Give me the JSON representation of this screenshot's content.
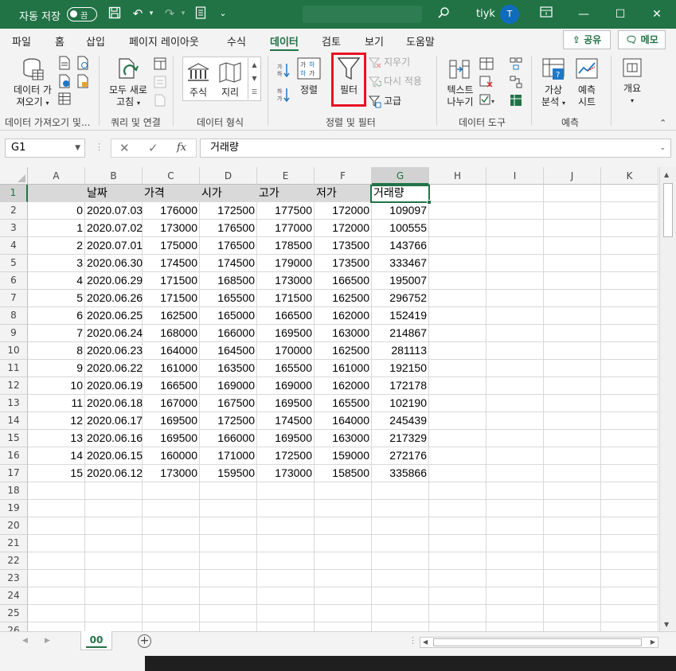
{
  "titlebar": {
    "autosave_label": "자동 저장",
    "autosave_state": "끔",
    "user_name": "tiyk",
    "avatar_initial": "T"
  },
  "ribbon_tabs": [
    "파일",
    "홈",
    "삽입",
    "페이지 레이아웃",
    "수식",
    "데이터",
    "검토",
    "보기",
    "도움말"
  ],
  "active_tab": "데이터",
  "share_label": "공유",
  "memo_label": "메모",
  "ribbon": {
    "get_data_line1": "데이터 가",
    "get_data_line2": "져오기",
    "refresh_line1": "모두 새로",
    "refresh_line2": "고침",
    "stocks": "주식",
    "geography": "지리",
    "sort": "정렬",
    "filter": "필터",
    "clear": "지우기",
    "reapply": "다시 적용",
    "advanced": "고급",
    "text_to_columns_line1": "텍스트",
    "text_to_columns_line2": "나누기",
    "whatif_line1": "가상",
    "whatif_line2": "분석",
    "forecast_line1": "예측",
    "forecast_line2": "시트",
    "outline": "개요",
    "groups": [
      "데이터 가져오기 및...",
      "쿼리 및 연결",
      "데이터 형식",
      "정렬 및 필터",
      "데이터 도구",
      "예측"
    ]
  },
  "formula_bar": {
    "name_box": "G1",
    "fx_label": "fx",
    "formula": "거래량"
  },
  "columns": [
    "A",
    "B",
    "C",
    "D",
    "E",
    "F",
    "G",
    "H",
    "I",
    "J",
    "K"
  ],
  "header_row": [
    "",
    "날짜",
    "가격",
    "시가",
    "고가",
    "저가",
    "거래량"
  ],
  "data_rows": [
    [
      "0",
      "2020.07.03",
      "176000",
      "172500",
      "177500",
      "172000",
      "109097"
    ],
    [
      "1",
      "2020.07.02",
      "173000",
      "176500",
      "177000",
      "172000",
      "100555"
    ],
    [
      "2",
      "2020.07.01",
      "175000",
      "176500",
      "178500",
      "173500",
      "143766"
    ],
    [
      "3",
      "2020.06.30",
      "174500",
      "174500",
      "179000",
      "173500",
      "333467"
    ],
    [
      "4",
      "2020.06.29",
      "171500",
      "168500",
      "173000",
      "166500",
      "195007"
    ],
    [
      "5",
      "2020.06.26",
      "171500",
      "165500",
      "171500",
      "162500",
      "296752"
    ],
    [
      "6",
      "2020.06.25",
      "162500",
      "165000",
      "166500",
      "162000",
      "152419"
    ],
    [
      "7",
      "2020.06.24",
      "168000",
      "166000",
      "169500",
      "163000",
      "214867"
    ],
    [
      "8",
      "2020.06.23",
      "164000",
      "164500",
      "170000",
      "162500",
      "281113"
    ],
    [
      "9",
      "2020.06.22",
      "161000",
      "163500",
      "165500",
      "161000",
      "192150"
    ],
    [
      "10",
      "2020.06.19",
      "166500",
      "169000",
      "169000",
      "162000",
      "172178"
    ],
    [
      "11",
      "2020.06.18",
      "167000",
      "167500",
      "169500",
      "165500",
      "102190"
    ],
    [
      "12",
      "2020.06.17",
      "169500",
      "172500",
      "174500",
      "164000",
      "245439"
    ],
    [
      "13",
      "2020.06.16",
      "169500",
      "166000",
      "169500",
      "163000",
      "217329"
    ],
    [
      "14",
      "2020.06.15",
      "160000",
      "171000",
      "172500",
      "159000",
      "272176"
    ],
    [
      "15",
      "2020.06.12",
      "173000",
      "159500",
      "173000",
      "158500",
      "335866"
    ]
  ],
  "row_numbers": [
    "1",
    "2",
    "3",
    "4",
    "5",
    "6",
    "7",
    "8",
    "9",
    "10",
    "11",
    "12",
    "13",
    "14",
    "15",
    "16",
    "17",
    "18",
    "19",
    "20",
    "21",
    "22",
    "23",
    "24",
    "25",
    "26"
  ],
  "selected_cell": "G1",
  "sheet_tab": "00",
  "colors": {
    "accent": "#217346",
    "highlight": "#e81123"
  }
}
